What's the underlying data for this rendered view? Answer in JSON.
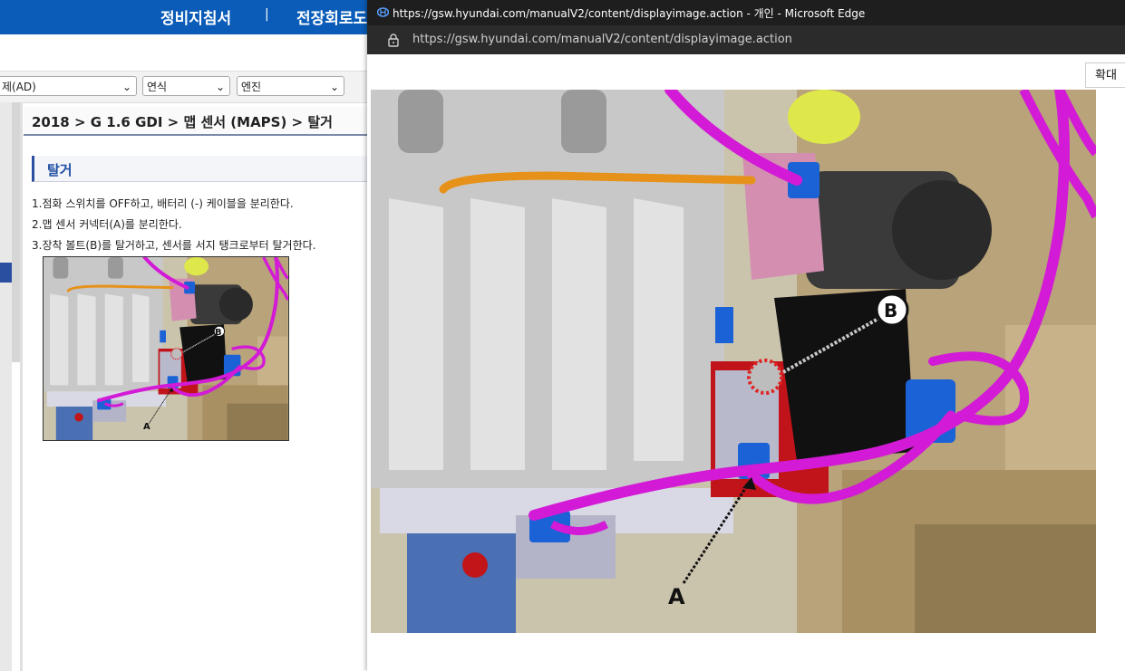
{
  "header": {
    "nav_items": [
      "정비지침서",
      "전장회로도"
    ],
    "separator": "|"
  },
  "filters": {
    "model": "제(AD)",
    "year": "연식",
    "engine": "엔진"
  },
  "breadcrumb": "2018 > G 1.6 GDI > 맵 센서 (MAPS) > 탈거",
  "section_title": "탈거",
  "steps": [
    "1.점화 스위치를 OFF하고, 배터리 (-) 케이블을 분리한다.",
    "2.맵 센서 커넥터(A)를 분리한다.",
    "3.장착 볼트(B)를 탈거하고, 센서를 서지 탱크로부터 탈거한다."
  ],
  "figure": {
    "label_a": "A",
    "label_b": "B"
  },
  "popup": {
    "title": "https://gsw.hyundai.com/manualV2/content/displayimage.action - 개인 - Microsoft Edge",
    "url": "https://gsw.hyundai.com/manualV2/content/displayimage.action",
    "zoom_label": "확대"
  },
  "colors": {
    "brand_blue": "#0a5cb8",
    "harness": "#d31ad6",
    "connector": "#1a62d6",
    "sensor": "#111111"
  }
}
